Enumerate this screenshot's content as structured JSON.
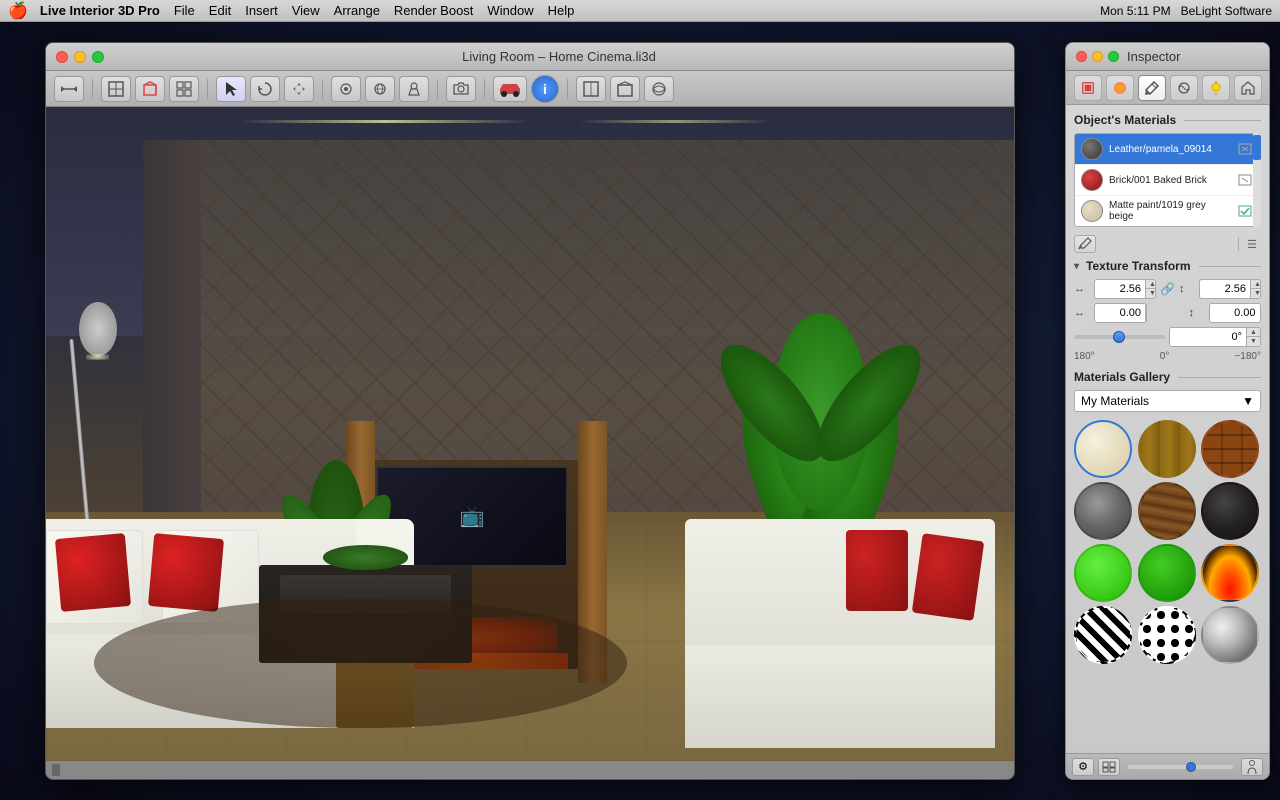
{
  "menubar": {
    "apple": "🍎",
    "items": [
      "Live Interior 3D Pro",
      "File",
      "Edit",
      "Insert",
      "View",
      "Arrange",
      "Render Boost",
      "Window",
      "Help"
    ],
    "right": {
      "time": "Mon 5:11 PM",
      "company": "BeLight Software"
    }
  },
  "mainWindow": {
    "title": "Living Room – Home Cinema.li3d",
    "trafficLights": [
      "close",
      "minimize",
      "maximize"
    ]
  },
  "toolbar": {
    "buttons": [
      "←→",
      "⊞",
      "📋",
      "≡",
      "↖",
      "↻",
      "⊕",
      "●",
      "◎",
      "◉",
      "✂",
      "📷",
      "🏠",
      "🔵",
      "ⓘ",
      "▣",
      "⌂",
      "🏠"
    ]
  },
  "inspector": {
    "title": "Inspector",
    "tabs": [
      {
        "id": "materials-tab",
        "icon": "🧱",
        "active": false
      },
      {
        "id": "color-tab",
        "icon": "🔴",
        "active": false
      },
      {
        "id": "paint-tab",
        "icon": "✏️",
        "active": true
      },
      {
        "id": "texture-tab",
        "icon": "🎨",
        "active": false
      },
      {
        "id": "light-tab",
        "icon": "💡",
        "active": false
      },
      {
        "id": "room-tab",
        "icon": "🏠",
        "active": false
      }
    ],
    "objectsMaterials": {
      "label": "Object's Materials",
      "items": [
        {
          "id": "mat-1",
          "name": "Leather/pamela_09014",
          "color": "#555",
          "selected": true
        },
        {
          "id": "mat-2",
          "name": "Brick/001 Baked Brick",
          "color": "#cc2222",
          "selected": false
        },
        {
          "id": "mat-3",
          "name": "Matte paint/1019 grey beige",
          "color": "#d4c8a8",
          "selected": false
        }
      ]
    },
    "textureTransform": {
      "label": "Texture Transform",
      "scaleX": "2.56",
      "scaleY": "2.56",
      "offsetX": "0.00",
      "offsetY": "0.00",
      "angle": "0°",
      "angleMin": "−180°",
      "angleMax": "180°",
      "angleMid": "0°"
    },
    "materialsGallery": {
      "label": "Materials Gallery",
      "dropdown": "My Materials",
      "items": [
        {
          "id": "g-cream",
          "class": "mat-cream",
          "selected": true
        },
        {
          "id": "g-wood1",
          "class": "mat-wood1",
          "selected": false
        },
        {
          "id": "g-brick",
          "class": "mat-brick",
          "selected": false
        },
        {
          "id": "g-stone",
          "class": "mat-stone",
          "selected": false
        },
        {
          "id": "g-wood2",
          "class": "mat-wood2",
          "selected": false
        },
        {
          "id": "g-dark",
          "class": "mat-dark",
          "selected": false
        },
        {
          "id": "g-green1",
          "class": "mat-green1",
          "selected": false
        },
        {
          "id": "g-green2",
          "class": "mat-green2",
          "selected": false
        },
        {
          "id": "g-fire",
          "class": "mat-fire",
          "selected": false
        },
        {
          "id": "g-zebra",
          "class": "mat-zebra",
          "selected": false
        },
        {
          "id": "g-spot",
          "class": "mat-spot",
          "selected": false
        },
        {
          "id": "g-metal",
          "class": "mat-metal",
          "selected": false
        }
      ]
    }
  }
}
